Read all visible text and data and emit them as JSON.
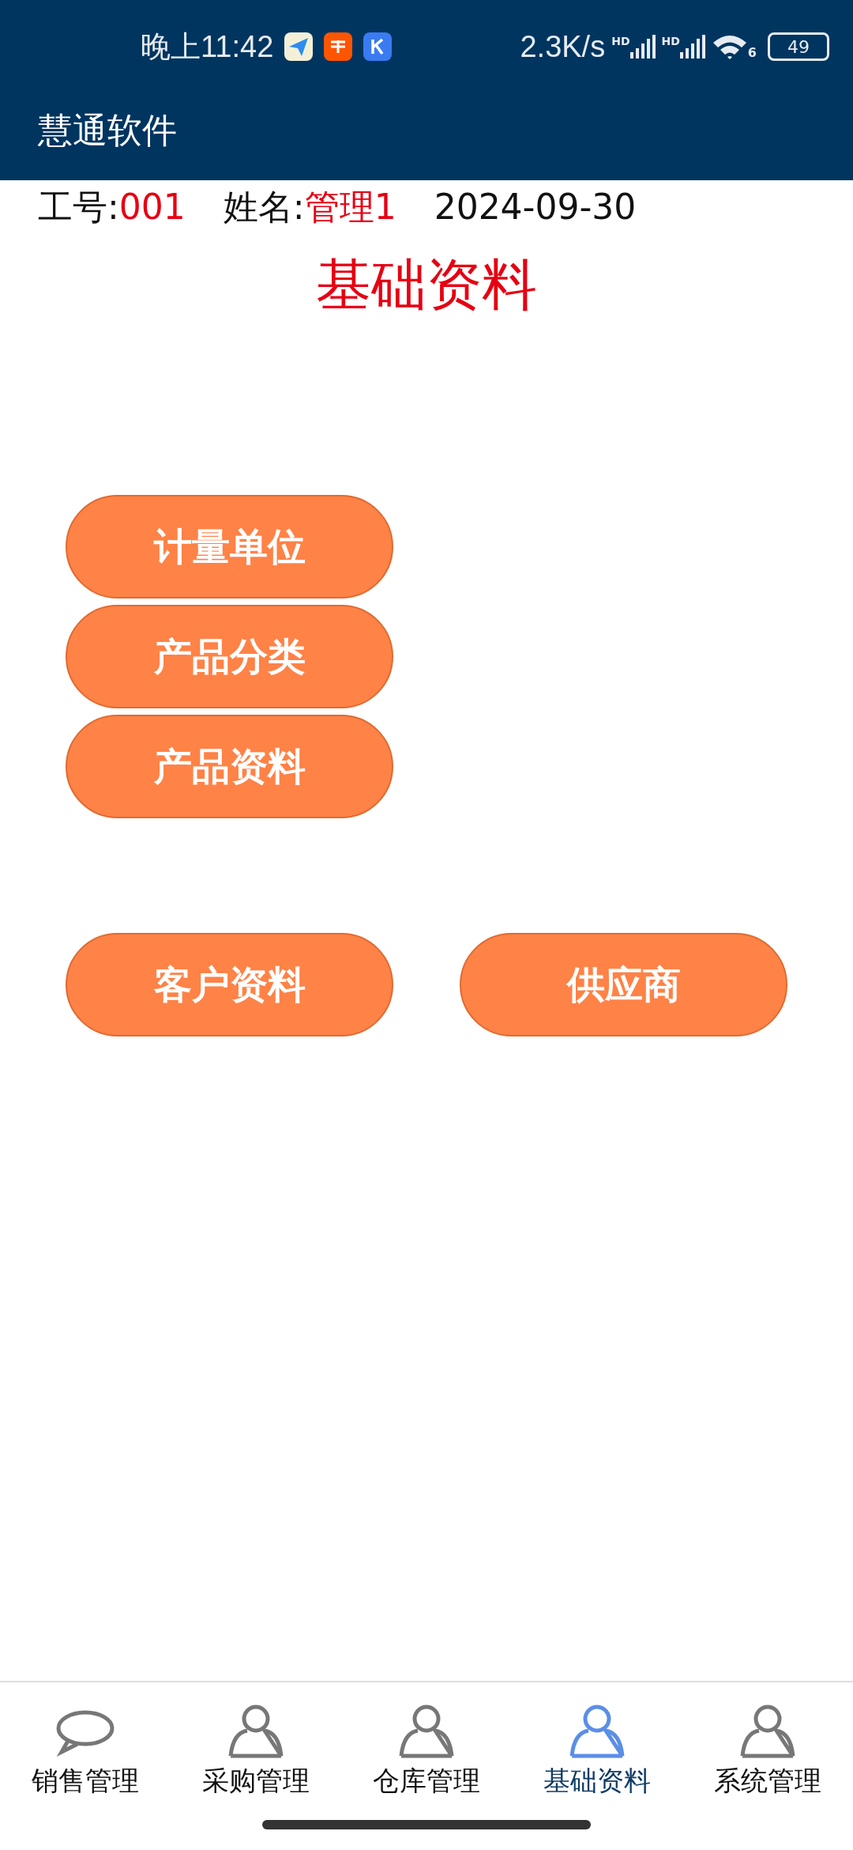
{
  "status_bar": {
    "time": "晚上11:42",
    "net_speed": "2.3K/s",
    "signals": [
      {
        "label": "HD"
      },
      {
        "label": "HD"
      }
    ],
    "wifi_label": "6",
    "battery": "49"
  },
  "app_bar": {
    "title": "慧通软件"
  },
  "info": {
    "fields": [
      {
        "label": "工号:",
        "value": "001"
      },
      {
        "label": "姓名:",
        "value": "管理1"
      }
    ],
    "date": "2024-09-30"
  },
  "heading": "基础资料",
  "button_groups": [
    {
      "kind": "column",
      "buttons": [
        "计量单位",
        "产品分类",
        "产品资料"
      ]
    },
    {
      "kind": "row",
      "buttons": [
        "客户资料",
        "供应商"
      ]
    }
  ],
  "tabs": [
    {
      "label": "销售管理",
      "kind": "chat",
      "selected": false
    },
    {
      "label": "采购管理",
      "kind": "person",
      "selected": false
    },
    {
      "label": "仓库管理",
      "kind": "person",
      "selected": false
    },
    {
      "label": "基础资料",
      "kind": "person",
      "selected": true
    },
    {
      "label": "系统管理",
      "kind": "person",
      "selected": false
    }
  ]
}
